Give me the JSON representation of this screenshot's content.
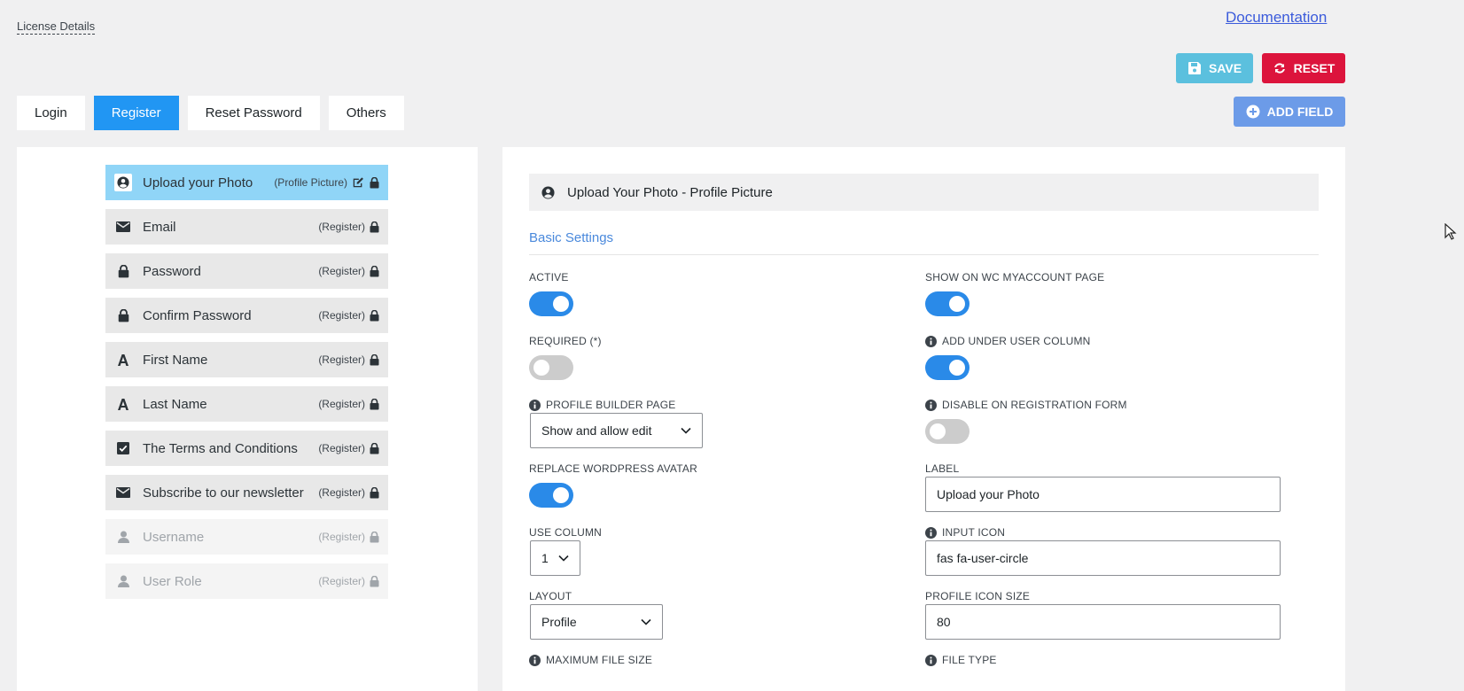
{
  "header": {
    "license_label": "License Details",
    "documentation_link": "Documentation"
  },
  "toolbar": {
    "save_label": "SAVE",
    "reset_label": "RESET",
    "add_field_label": "ADD FIELD"
  },
  "tabs": [
    {
      "label": "Login"
    },
    {
      "label": "Register",
      "active": true
    },
    {
      "label": "Reset Password"
    },
    {
      "label": "Others"
    }
  ],
  "fields": [
    {
      "label": "Upload your Photo",
      "tag": "(Profile Picture)",
      "icon": "user-circle-icon",
      "state": "selected"
    },
    {
      "label": "Email",
      "tag": "(Register)",
      "icon": "envelope-icon",
      "state": "normal"
    },
    {
      "label": "Password",
      "tag": "(Register)",
      "icon": "lock-icon",
      "state": "normal"
    },
    {
      "label": "Confirm Password",
      "tag": "(Register)",
      "icon": "lock-icon",
      "state": "normal"
    },
    {
      "label": "First Name",
      "tag": "(Register)",
      "icon": "font-icon",
      "state": "normal"
    },
    {
      "label": "Last Name",
      "tag": "(Register)",
      "icon": "font-icon",
      "state": "normal"
    },
    {
      "label": "The Terms and Conditions",
      "tag": "(Register)",
      "icon": "check-square-icon",
      "state": "normal"
    },
    {
      "label": "Subscribe to our newsletter",
      "tag": "(Register)",
      "icon": "envelope-icon",
      "state": "normal"
    },
    {
      "label": "Username",
      "tag": "(Register)",
      "icon": "user-icon",
      "state": "disabled"
    },
    {
      "label": "User Role",
      "tag": "(Register)",
      "icon": "user-icon",
      "state": "disabled"
    }
  ],
  "settings": {
    "title": "Upload Your Photo - Profile Picture",
    "section": "Basic Settings",
    "active": {
      "label": "ACTIVE",
      "on": true
    },
    "show_wc": {
      "label": "SHOW ON WC MYACCOUNT PAGE",
      "on": true
    },
    "required": {
      "label": "REQUIRED (*)",
      "on": false
    },
    "add_user_column": {
      "label": "ADD UNDER USER COLUMN",
      "on": true
    },
    "profile_builder_page": {
      "label": "PROFILE BUILDER PAGE",
      "value": "Show and allow edit"
    },
    "disable_registration": {
      "label": "DISABLE ON REGISTRATION FORM",
      "on": false
    },
    "replace_avatar": {
      "label": "REPLACE WORDPRESS AVATAR",
      "on": true
    },
    "label_field": {
      "label": "LABEL",
      "value": "Upload your Photo"
    },
    "use_column": {
      "label": "USE COLUMN",
      "value": "1"
    },
    "input_icon": {
      "label": "INPUT ICON",
      "value": "fas fa-user-circle"
    },
    "layout": {
      "label": "LAYOUT",
      "value": "Profile"
    },
    "profile_icon_size": {
      "label": "PROFILE ICON SIZE",
      "value": "80"
    },
    "max_file_size": {
      "label": "MAXIMUM FILE SIZE"
    },
    "file_type": {
      "label": "FILE TYPE"
    }
  },
  "colors": {
    "accent": "#2196f3",
    "save": "#5bc0de",
    "reset": "#dc143c",
    "add": "#6c9be8",
    "toggle_on": "#2a8ae8",
    "toggle_off": "#cccccc"
  }
}
